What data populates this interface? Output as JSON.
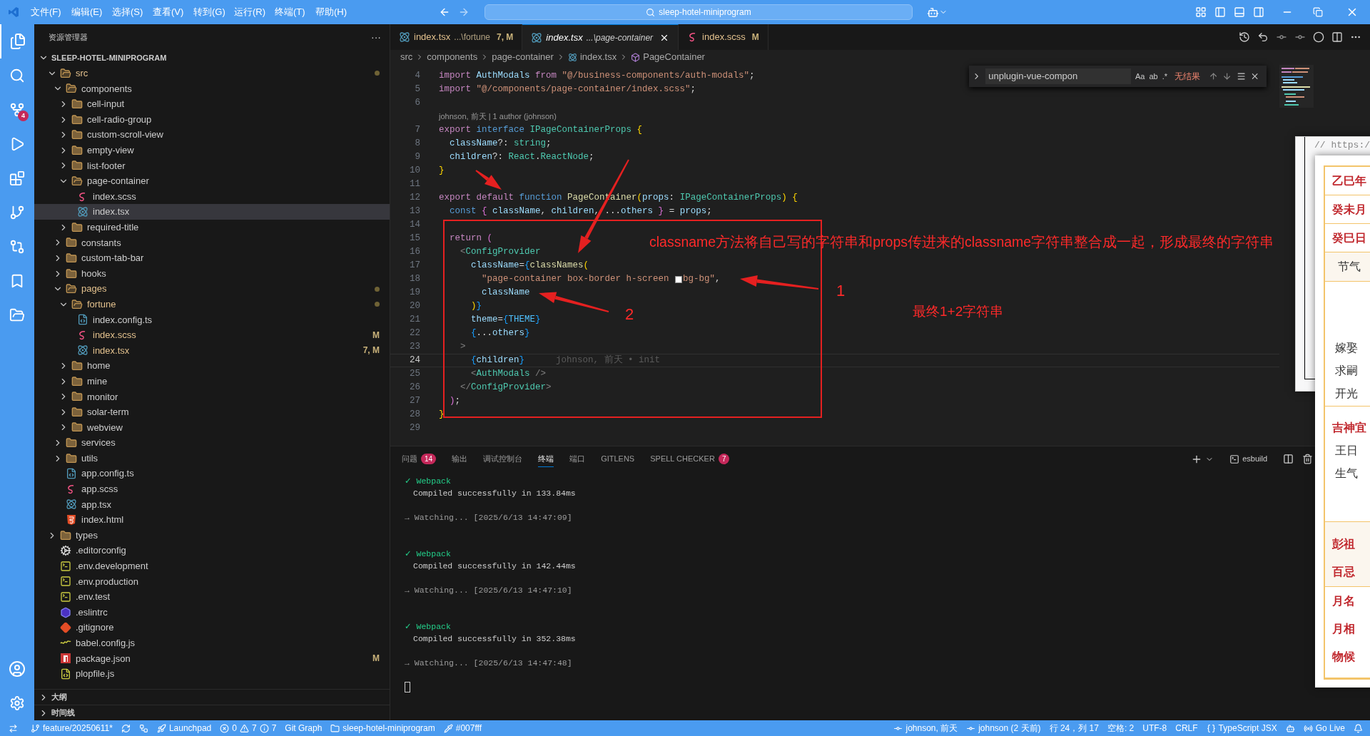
{
  "title_bar": {
    "menus": [
      "文件(F)",
      "编辑(E)",
      "选择(S)",
      "查看(V)",
      "转到(G)",
      "运行(R)",
      "终端(T)",
      "帮助(H)"
    ],
    "search": "sleep-hotel-miniprogram"
  },
  "activity_bar": {
    "scm_badge": "4"
  },
  "sidebar": {
    "title": "资源管理器",
    "more": "···",
    "root": "SLEEP-HOTEL-MINIPROGRAM",
    "tree": [
      {
        "name": "src",
        "kind": "folder",
        "expanded": true,
        "selected": false,
        "modified": true,
        "dot": true,
        "children": [
          {
            "name": "components",
            "kind": "folder",
            "expanded": true,
            "selected": false,
            "modified": false,
            "dot": false,
            "children": [
              {
                "name": "cell-input",
                "kind": "folder",
                "expanded": false,
                "selected": false,
                "modified": false,
                "dot": false
              },
              {
                "name": "cell-radio-group",
                "kind": "folder",
                "expanded": false,
                "selected": false,
                "modified": false,
                "dot": false
              },
              {
                "name": "custom-scroll-view",
                "kind": "folder",
                "expanded": false,
                "selected": false,
                "modified": false,
                "dot": false
              },
              {
                "name": "empty-view",
                "kind": "folder",
                "expanded": false,
                "selected": false,
                "modified": false,
                "dot": false
              },
              {
                "name": "list-footer",
                "kind": "folder",
                "expanded": false,
                "selected": false,
                "modified": false,
                "dot": false
              },
              {
                "name": "page-container",
                "kind": "folder",
                "expanded": true,
                "selected": false,
                "modified": false,
                "dot": false,
                "children": [
                  {
                    "name": "index.scss",
                    "kind": "scss",
                    "selected": false,
                    "modified": false,
                    "dot": false
                  },
                  {
                    "name": "index.tsx",
                    "kind": "react",
                    "selected": true,
                    "modified": false,
                    "dot": false
                  }
                ]
              },
              {
                "name": "required-title",
                "kind": "folder",
                "expanded": false,
                "selected": false,
                "modified": false,
                "dot": false
              }
            ]
          },
          {
            "name": "constants",
            "kind": "folder",
            "expanded": false,
            "selected": false,
            "modified": false,
            "dot": false
          },
          {
            "name": "custom-tab-bar",
            "kind": "folder",
            "expanded": false,
            "selected": false,
            "modified": false,
            "dot": false
          },
          {
            "name": "hooks",
            "kind": "folder",
            "expanded": false,
            "selected": false,
            "modified": false,
            "dot": false
          },
          {
            "name": "pages",
            "kind": "folder",
            "expanded": true,
            "selected": false,
            "modified": true,
            "dot": true,
            "children": [
              {
                "name": "fortune",
                "kind": "folder",
                "expanded": true,
                "selected": false,
                "modified": true,
                "dot": true,
                "children": [
                  {
                    "name": "index.config.ts",
                    "kind": "ts",
                    "selected": false,
                    "modified": false,
                    "dot": false
                  },
                  {
                    "name": "index.scss",
                    "kind": "scss",
                    "selected": false,
                    "modified": true,
                    "dot": false,
                    "badge": "M"
                  },
                  {
                    "name": "index.tsx",
                    "kind": "react",
                    "selected": false,
                    "modified": true,
                    "dot": false,
                    "badge": "7, M"
                  }
                ]
              },
              {
                "name": "home",
                "kind": "folder",
                "expanded": false,
                "selected": false,
                "modified": false,
                "dot": false
              },
              {
                "name": "mine",
                "kind": "folder",
                "expanded": false,
                "selected": false,
                "modified": false,
                "dot": false
              },
              {
                "name": "monitor",
                "kind": "folder",
                "expanded": false,
                "selected": false,
                "modified": false,
                "dot": false
              },
              {
                "name": "solar-term",
                "kind": "folder",
                "expanded": false,
                "selected": false,
                "modified": false,
                "dot": false
              },
              {
                "name": "webview",
                "kind": "folder",
                "expanded": false,
                "selected": false,
                "modified": false,
                "dot": false
              }
            ]
          },
          {
            "name": "services",
            "kind": "folder",
            "expanded": false,
            "selected": false,
            "modified": false,
            "dot": false
          },
          {
            "name": "utils",
            "kind": "folder",
            "expanded": false,
            "selected": false,
            "modified": false,
            "dot": false
          },
          {
            "name": "app.config.ts",
            "kind": "ts",
            "selected": false,
            "modified": false,
            "dot": false
          },
          {
            "name": "app.scss",
            "kind": "scss",
            "selected": false,
            "modified": false,
            "dot": false
          },
          {
            "name": "app.tsx",
            "kind": "react",
            "selected": false,
            "modified": false,
            "dot": false
          },
          {
            "name": "index.html",
            "kind": "html",
            "selected": false,
            "modified": false,
            "dot": false
          }
        ]
      },
      {
        "name": "types",
        "kind": "folder",
        "expanded": false,
        "selected": false,
        "modified": false,
        "dot": false
      },
      {
        "name": ".editorconfig",
        "kind": "config",
        "selected": false,
        "modified": false,
        "dot": false
      },
      {
        "name": ".env.development",
        "kind": "env",
        "selected": false,
        "modified": false,
        "dot": false
      },
      {
        "name": ".env.production",
        "kind": "env",
        "selected": false,
        "modified": false,
        "dot": false
      },
      {
        "name": ".env.test",
        "kind": "env",
        "selected": false,
        "modified": false,
        "dot": false
      },
      {
        "name": ".eslintrc",
        "kind": "eslint",
        "selected": false,
        "modified": false,
        "dot": false
      },
      {
        "name": ".gitignore",
        "kind": "git",
        "selected": false,
        "modified": false,
        "dot": false
      },
      {
        "name": "babel.config.js",
        "kind": "babel",
        "selected": false,
        "modified": false,
        "dot": false
      },
      {
        "name": "package.json",
        "kind": "npm",
        "selected": false,
        "modified": false,
        "dot": false,
        "badge": "M"
      },
      {
        "name": "plopfile.js",
        "kind": "js",
        "selected": false,
        "modified": false,
        "dot": false
      }
    ],
    "sections": [
      "大纲",
      "时间线"
    ]
  },
  "tabs": [
    {
      "name": "index.tsx",
      "path": "...\\fortune",
      "badge": "7, M",
      "selected": false,
      "modified": true
    },
    {
      "name": "index.tsx",
      "path": "...\\page-container",
      "selected": true,
      "modified": false
    },
    {
      "name": "index.scss",
      "badge": "M",
      "selected": false,
      "modified": true,
      "kind": "scss"
    }
  ],
  "breadcrumb": [
    "src",
    "components",
    "page-container",
    "index.tsx",
    "PageContainer"
  ],
  "find": {
    "value": "unplugin-vue-compon",
    "options": [
      "Aa",
      "ab",
      ".*"
    ],
    "result": "无结果"
  },
  "code": [
    {
      "kind": "code",
      "n": "4",
      "current": false,
      "tokens": [
        {
          "kind": "kw",
          "text": "import"
        },
        {
          "kind": "var",
          "text": " AuthModals"
        },
        {
          "kind": "kw",
          "text": " from"
        },
        {
          "kind": "str",
          "text": " \"@/business-components/auth-modals\""
        },
        {
          "kind": "p",
          "text": ";"
        }
      ]
    },
    {
      "kind": "code",
      "n": "5",
      "current": false,
      "tokens": [
        {
          "kind": "kw",
          "text": "import"
        },
        {
          "kind": "str",
          "text": " \"@/components/page-container/index.scss\""
        },
        {
          "kind": "p",
          "text": ";"
        }
      ]
    },
    {
      "kind": "code",
      "n": "6",
      "current": false
    },
    {
      "kind": "lens",
      "text": "johnson, 前天 | 1 author (johnson)"
    },
    {
      "kind": "code",
      "n": "7",
      "current": false,
      "tokens": [
        {
          "kind": "kw",
          "text": "export"
        },
        {
          "kind": "st",
          "text": " interface"
        },
        {
          "kind": "type",
          "text": " IPageContainerProps"
        },
        {
          "kind": "b1",
          "text": " {"
        }
      ]
    },
    {
      "kind": "code",
      "n": "8",
      "current": false,
      "tokens": [
        {
          "kind": "var",
          "text": "  className"
        },
        {
          "kind": "p",
          "text": "?: "
        },
        {
          "kind": "type",
          "text": "string"
        },
        {
          "kind": "p",
          "text": ";"
        }
      ]
    },
    {
      "kind": "code",
      "n": "9",
      "current": false,
      "tokens": [
        {
          "kind": "var",
          "text": "  children"
        },
        {
          "kind": "p",
          "text": "?: "
        },
        {
          "kind": "type",
          "text": "React"
        },
        {
          "kind": "p",
          "text": "."
        },
        {
          "kind": "type",
          "text": "ReactNode"
        },
        {
          "kind": "p",
          "text": ";"
        }
      ]
    },
    {
      "kind": "code",
      "n": "10",
      "current": false,
      "tokens": [
        {
          "kind": "b1",
          "text": "}"
        }
      ]
    },
    {
      "kind": "code",
      "n": "11",
      "current": false
    },
    {
      "kind": "code",
      "n": "12",
      "current": false,
      "tokens": [
        {
          "kind": "kw",
          "text": "export"
        },
        {
          "kind": "kw",
          "text": " default"
        },
        {
          "kind": "st",
          "text": " function"
        },
        {
          "kind": "fn",
          "text": " PageContainer"
        },
        {
          "kind": "b1",
          "text": "("
        },
        {
          "kind": "var",
          "text": "props"
        },
        {
          "kind": "p",
          "text": ": "
        },
        {
          "kind": "type",
          "text": "IPageContainerProps"
        },
        {
          "kind": "b1",
          "text": ")"
        },
        {
          "kind": "b1",
          "text": " {"
        }
      ]
    },
    {
      "kind": "code",
      "n": "13",
      "current": false,
      "tokens": [
        {
          "kind": "st",
          "text": "  const"
        },
        {
          "kind": "b2",
          "text": " {"
        },
        {
          "kind": "var",
          "text": " className"
        },
        {
          "kind": "p",
          "text": ", "
        },
        {
          "kind": "var",
          "text": "children"
        },
        {
          "kind": "p",
          "text": ", ..."
        },
        {
          "kind": "var",
          "text": "others"
        },
        {
          "kind": "b2",
          "text": " }"
        },
        {
          "kind": "p",
          "text": " = "
        },
        {
          "kind": "var",
          "text": "props"
        },
        {
          "kind": "p",
          "text": ";"
        }
      ]
    },
    {
      "kind": "code",
      "n": "14",
      "current": false
    },
    {
      "kind": "code",
      "n": "15",
      "current": false,
      "tokens": [
        {
          "kind": "kw",
          "text": "  return"
        },
        {
          "kind": "b2",
          "text": " ("
        }
      ]
    },
    {
      "kind": "code",
      "n": "16",
      "current": false,
      "tokens": [
        {
          "kind": "tagp",
          "text": "    <"
        },
        {
          "kind": "type",
          "text": "ConfigProvider"
        }
      ]
    },
    {
      "kind": "code",
      "n": "17",
      "current": false,
      "tokens": [
        {
          "kind": "var",
          "text": "      className"
        },
        {
          "kind": "p",
          "text": "="
        },
        {
          "kind": "b3",
          "text": "{"
        },
        {
          "kind": "fn",
          "text": "classNames"
        },
        {
          "kind": "b1",
          "text": "("
        }
      ]
    },
    {
      "kind": "code",
      "n": "18",
      "current": false,
      "tokens": [
        {
          "kind": "str",
          "text": "        \"page-container box-border h-screen "
        },
        {
          "kind": "swatch"
        },
        {
          "kind": "str",
          "text": "bg-bg\""
        },
        {
          "kind": "p",
          "text": ","
        }
      ]
    },
    {
      "kind": "code",
      "n": "19",
      "current": false,
      "tokens": [
        {
          "kind": "var",
          "text": "        className"
        }
      ]
    },
    {
      "kind": "code",
      "n": "20",
      "current": false,
      "tokens": [
        {
          "kind": "b1",
          "text": "      )"
        },
        {
          "kind": "b3",
          "text": "}"
        }
      ]
    },
    {
      "kind": "code",
      "n": "21",
      "current": false,
      "tokens": [
        {
          "kind": "var",
          "text": "      theme"
        },
        {
          "kind": "p",
          "text": "="
        },
        {
          "kind": "b3",
          "text": "{"
        },
        {
          "kind": "const",
          "text": "THEME"
        },
        {
          "kind": "b3",
          "text": "}"
        }
      ]
    },
    {
      "kind": "code",
      "n": "22",
      "current": false,
      "tokens": [
        {
          "kind": "b3",
          "text": "      {"
        },
        {
          "kind": "p",
          "text": "..."
        },
        {
          "kind": "var",
          "text": "others"
        },
        {
          "kind": "b3",
          "text": "}"
        }
      ]
    },
    {
      "kind": "code",
      "n": "23",
      "current": false,
      "tokens": [
        {
          "kind": "tagp",
          "text": "    >"
        }
      ]
    },
    {
      "kind": "code",
      "n": "24",
      "current": true,
      "blame": "johnson, 前天 • init",
      "tokens": [
        {
          "kind": "b3",
          "text": "      {"
        },
        {
          "kind": "var",
          "text": "children"
        },
        {
          "kind": "b3",
          "text": "}"
        }
      ]
    },
    {
      "kind": "code",
      "n": "25",
      "current": false,
      "tokens": [
        {
          "kind": "tagp",
          "text": "      <"
        },
        {
          "kind": "type",
          "text": "AuthModals"
        },
        {
          "kind": "tagp",
          "text": " />"
        }
      ]
    },
    {
      "kind": "code",
      "n": "26",
      "current": false,
      "tokens": [
        {
          "kind": "tagp",
          "text": "    </"
        },
        {
          "kind": "type",
          "text": "ConfigProvider"
        },
        {
          "kind": "tagp",
          "text": ">"
        }
      ]
    },
    {
      "kind": "code",
      "n": "27",
      "current": false,
      "tokens": [
        {
          "kind": "b2",
          "text": "  )"
        },
        {
          "kind": "p",
          "text": ";"
        }
      ]
    },
    {
      "kind": "code",
      "n": "28",
      "current": false,
      "tokens": [
        {
          "kind": "b1",
          "text": "}"
        }
      ]
    },
    {
      "kind": "code",
      "n": "29",
      "current": false
    }
  ],
  "annotations": {
    "note": "classname方法将自己写的字符串和props传进来的classname字符串整合成一起，形成最终的字符串",
    "label_1": "1",
    "label_2": "2",
    "summary": "最终1+2字符串"
  },
  "panel": {
    "tabs": [
      {
        "label": "问题",
        "count": "14",
        "selected": false
      },
      {
        "label": "输出",
        "selected": false
      },
      {
        "label": "调试控制台",
        "selected": false
      },
      {
        "label": "终端",
        "selected": true
      },
      {
        "label": "端口",
        "selected": false
      },
      {
        "label": "GITLENS",
        "selected": false
      },
      {
        "label": "SPELL CHECKER",
        "count": "7",
        "selected": false
      }
    ],
    "profile": "esbuild",
    "lines": [
      {
        "kind": "ok",
        "mark": "✓",
        "text": "Webpack"
      },
      {
        "kind": "info",
        "text": "Compiled successfully in 133.84ms"
      },
      {
        "kind": "blank"
      },
      {
        "kind": "watch",
        "text": "→ Watching... [2025/6/13 14:47:09]"
      },
      {
        "kind": "blank"
      },
      {
        "kind": "blank"
      },
      {
        "kind": "ok",
        "mark": "✓",
        "text": "Webpack"
      },
      {
        "kind": "info",
        "text": "Compiled successfully in 142.44ms"
      },
      {
        "kind": "blank"
      },
      {
        "kind": "watch",
        "text": "→ Watching... [2025/6/13 14:47:10]"
      },
      {
        "kind": "blank"
      },
      {
        "kind": "blank"
      },
      {
        "kind": "ok",
        "mark": "✓",
        "text": "Webpack"
      },
      {
        "kind": "info",
        "text": "Compiled successfully in 352.38ms"
      },
      {
        "kind": "blank"
      },
      {
        "kind": "watch",
        "text": "→ Watching... [2025/6/13 14:47:48]"
      },
      {
        "kind": "blank"
      },
      {
        "kind": "cursor"
      }
    ]
  },
  "calendar_popup": {
    "back_text": "// https:/",
    "sections": [
      {
        "kind": "head",
        "lines": [
          "乙巳年"
        ]
      },
      {
        "kind": "head",
        "lines": [
          "癸未月"
        ]
      },
      {
        "kind": "head",
        "lines": [
          "癸巳日"
        ]
      },
      {
        "kind": "band",
        "lines": [
          "节气"
        ]
      },
      {
        "kind": "plain",
        "lines": [
          "嫁娶",
          "求嗣",
          "开光"
        ]
      },
      {
        "kind": "titled",
        "title": "吉神宜",
        "lines": [
          "王日",
          "生气"
        ]
      },
      {
        "kind": "head_band",
        "lines": [
          "彭祖",
          "百忌"
        ]
      },
      {
        "kind": "head",
        "lines": [
          "月名",
          "月相",
          "物候"
        ]
      }
    ]
  },
  "status_bar": {
    "left": [
      {
        "kind": "remote"
      },
      {
        "kind": "branch",
        "text": "feature/20250611*"
      },
      {
        "kind": "sync"
      },
      {
        "kind": "graph"
      },
      {
        "kind": "launchpad",
        "text": "Launchpad"
      },
      {
        "kind": "problems",
        "errors": "0",
        "warnings": "7",
        "infos": "7"
      },
      {
        "kind": "text",
        "text": "Git Graph"
      },
      {
        "kind": "folder",
        "text": "sleep-hotel-miniprogram"
      },
      {
        "kind": "color",
        "text": "#007fff"
      }
    ],
    "right": [
      {
        "kind": "commit",
        "text": "johnson, 前天"
      },
      {
        "kind": "commit",
        "text": "johnson (2 天前)"
      },
      {
        "kind": "text",
        "text": "行 24，列 17"
      },
      {
        "kind": "text",
        "text": "空格: 2"
      },
      {
        "kind": "text",
        "text": "UTF-8"
      },
      {
        "kind": "text",
        "text": "CRLF"
      },
      {
        "kind": "braces",
        "text": "TypeScript JSX"
      },
      {
        "kind": "copilot"
      },
      {
        "kind": "live",
        "text": "Go Live"
      },
      {
        "kind": "bell"
      }
    ]
  }
}
